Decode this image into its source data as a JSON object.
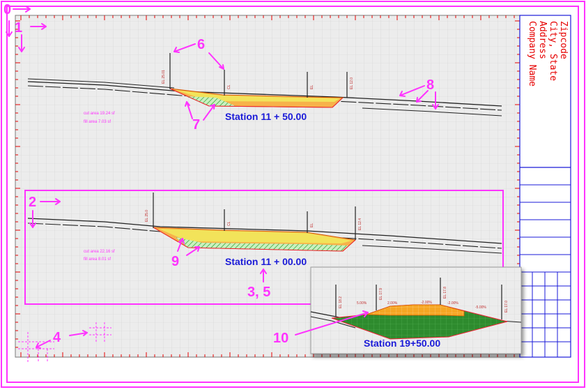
{
  "sheet": {
    "callouts": {
      "c0": "0",
      "c1": "1",
      "c2": "2",
      "c35": "3, 5",
      "c4": "4",
      "c6": "6",
      "c7": "7",
      "c8": "8",
      "c9": "9",
      "c10": "10"
    },
    "title_block": {
      "company": "Company Name",
      "address": "Address",
      "city": "City, State",
      "zip": "Zipcode"
    },
    "sections": [
      {
        "station_label": "Station 11 + 50.00"
      },
      {
        "station_label": "Station 11 + 00.00"
      }
    ],
    "inset": {
      "station_label": "Station 19+50.00",
      "slope_labels": [
        "5.00%",
        "2.00%",
        "-2.00%",
        "-2.00%",
        "-5.00%"
      ]
    }
  },
  "colors": {
    "callout": "#ff33ff",
    "frame": "#ff33ff",
    "station_text": "#1a1ad8",
    "title_block": "#e60000",
    "grid": "#d2d2d2",
    "cut_fill": "#f5a623",
    "pavement": "#f2e35a",
    "fill_hatch": "#2ca02c"
  }
}
